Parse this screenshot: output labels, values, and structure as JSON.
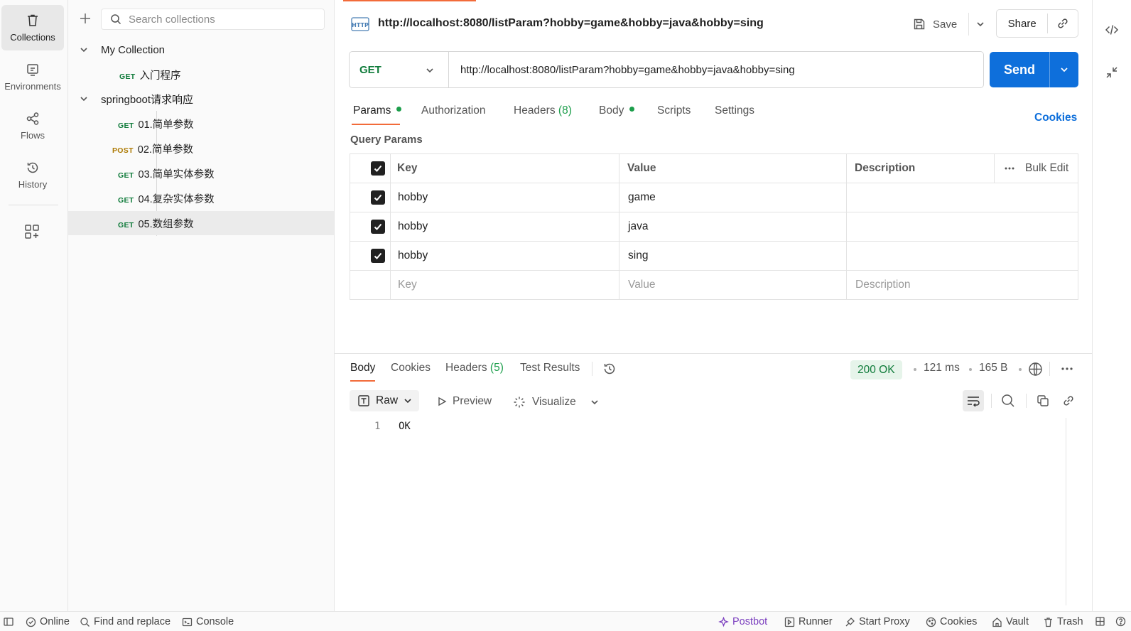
{
  "rail": {
    "items": [
      {
        "label": "Collections",
        "icon": "trash-can-icon"
      },
      {
        "label": "Environments",
        "icon": "environment-icon"
      },
      {
        "label": "Flows",
        "icon": "flows-icon"
      },
      {
        "label": "History",
        "icon": "history-icon"
      }
    ]
  },
  "sidebar": {
    "search_placeholder": "Search collections",
    "collections": [
      {
        "name": "My Collection",
        "requests": [
          {
            "method": "GET",
            "name": "入门程序"
          }
        ]
      },
      {
        "name": "springboot请求响应",
        "requests": [
          {
            "method": "GET",
            "name": "01.简单参数"
          },
          {
            "method": "POST",
            "name": "02.简单参数"
          },
          {
            "method": "GET",
            "name": "03.简单实体参数"
          },
          {
            "method": "GET",
            "name": "04.复杂实体参数"
          },
          {
            "method": "GET",
            "name": "05.数组参数"
          }
        ]
      }
    ]
  },
  "request": {
    "title": "http://localhost:8080/listParam?hobby=game&hobby=java&hobby=sing",
    "save_label": "Save",
    "share_label": "Share",
    "method": "GET",
    "url": "http://localhost:8080/listParam?hobby=game&hobby=java&hobby=sing",
    "send_label": "Send",
    "tabs": {
      "params": "Params",
      "authorization": "Authorization",
      "headers": "Headers",
      "headers_count": "(8)",
      "body": "Body",
      "scripts": "Scripts",
      "settings": "Settings"
    },
    "cookies_label": "Cookies",
    "query_params_label": "Query Params",
    "table": {
      "col_key": "Key",
      "col_value": "Value",
      "col_description": "Description",
      "bulk_edit": "Bulk Edit",
      "rows": [
        {
          "key": "hobby",
          "value": "game",
          "description": ""
        },
        {
          "key": "hobby",
          "value": "java",
          "description": ""
        },
        {
          "key": "hobby",
          "value": "sing",
          "description": ""
        }
      ],
      "placeholder": {
        "key": "Key",
        "value": "Value",
        "description": "Description"
      }
    }
  },
  "response": {
    "tabs": {
      "body": "Body",
      "cookies": "Cookies",
      "headers": "Headers",
      "headers_count": "(5)",
      "test_results": "Test Results"
    },
    "status": "200 OK",
    "time": "121 ms",
    "size": "165 B",
    "format": "Raw",
    "preview_label": "Preview",
    "visualize_label": "Visualize",
    "lines": [
      {
        "n": "1",
        "text": "OK"
      }
    ]
  },
  "statusbar": {
    "online": "Online",
    "find_replace": "Find and replace",
    "console": "Console",
    "postbot": "Postbot",
    "runner": "Runner",
    "start_proxy": "Start Proxy",
    "cookies": "Cookies",
    "vault": "Vault",
    "trash": "Trash"
  },
  "colors": {
    "accent": "#f26b3a",
    "send": "#0e6fdb",
    "get": "#0f7b3a",
    "post": "#ad7a03",
    "status_ok_bg": "#e6f4ea",
    "postbot": "#7b3fbf"
  }
}
